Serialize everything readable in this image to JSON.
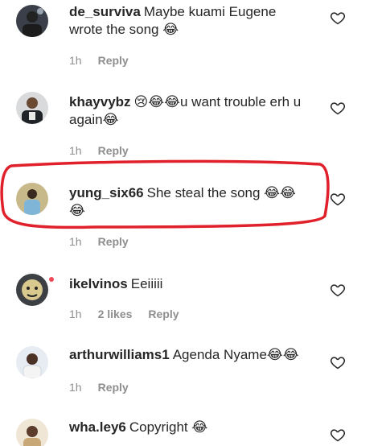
{
  "comments": [
    {
      "username": "de_surviva",
      "text": "Maybe kuami Eugene wrote the song 😂",
      "time": "1h",
      "likes": "",
      "reply": "Reply"
    },
    {
      "username": "khayvybz",
      "text": "😢😂😂u want trouble erh u again😂",
      "time": "1h",
      "likes": "",
      "reply": "Reply"
    },
    {
      "username": "yung_six66",
      "text": "She steal the song 😂😂😂",
      "time": "1h",
      "likes": "",
      "reply": "Reply"
    },
    {
      "username": "ikelvinos",
      "text": "Eeiiiii",
      "time": "1h",
      "likes": "2 likes",
      "reply": "Reply"
    },
    {
      "username": "arthurwilliams1",
      "text": "Agenda Nyame😂😂",
      "time": "1h",
      "likes": "",
      "reply": "Reply"
    },
    {
      "username": "wha.ley6",
      "text": "Copyright 😂",
      "time": "",
      "likes": "",
      "reply": ""
    }
  ],
  "icons": {
    "like": "heart-outline-icon"
  },
  "colors": {
    "highlight": "#e0202a",
    "meta": "#8e8e8e",
    "text": "#262626",
    "online": "#ed4956"
  }
}
